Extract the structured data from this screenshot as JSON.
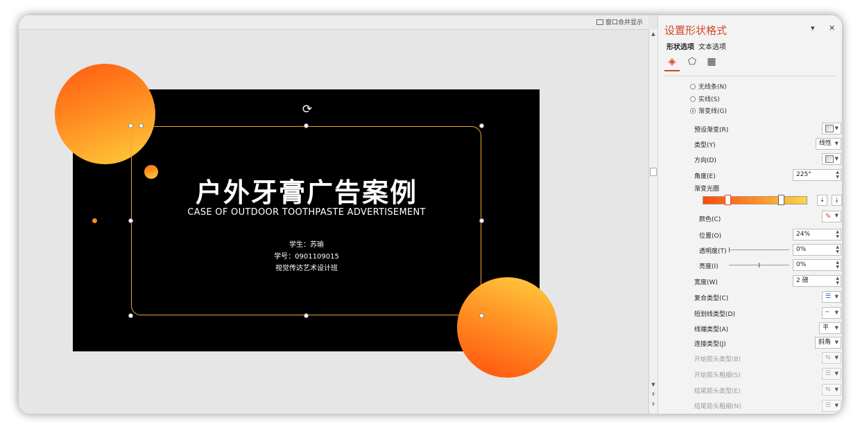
{
  "toolbar": {
    "merge_label": "窗口合并显示"
  },
  "slide": {
    "title": "户外牙膏广告案例",
    "subtitle": "CASE OF OUTDOOR TOOTHPASTE ADVERTISEMENT",
    "student": "学生：苏瑜",
    "student_id": "学号：0901109015",
    "class": "视觉传达艺术设计班"
  },
  "panel": {
    "title": "设置形状格式",
    "tabs": [
      "形状选项",
      "文本选项"
    ],
    "icons": [
      "fill-line-icon",
      "effects-icon",
      "size-properties-icon"
    ],
    "line_options": [
      {
        "label": "无线条(N)",
        "selected": false
      },
      {
        "label": "实线(S)",
        "selected": false
      },
      {
        "label": "渐变线(G)",
        "selected": true
      }
    ],
    "preset_gradient_label": "预设渐变(R)",
    "type_label": "类型(Y)",
    "type_value": "线性",
    "direction_label": "方向(D)",
    "angle_label": "角度(E)",
    "angle_value": "225°",
    "gradient_stops_label": "渐变光圈",
    "gradient_stop_positions": [
      0.24,
      0.75
    ],
    "color_label": "颜色(C)",
    "position_label": "位置(O)",
    "position_value": "24%",
    "transparency_label": "透明度(T)",
    "transparency_value": "0%",
    "brightness_label": "亮度(I)",
    "brightness_value": "0%",
    "width_label": "宽度(W)",
    "width_value": "2 磅",
    "compound_label": "复合类型(C)",
    "dash_label": "短划线类型(D)",
    "cap_label": "线端类型(A)",
    "cap_value": "平",
    "join_label": "连接类型(J)",
    "join_value": "斜角",
    "begin_arrow_type_label": "开始箭头类型(B)",
    "begin_arrow_size_label": "开始箭头粗细(S)",
    "end_arrow_type_label": "结尾箭头类型(E)",
    "end_arrow_size_label": "结尾箭头粗细(N)"
  },
  "colors": {
    "accent": "#d24726",
    "orange": "#ff5a10",
    "yellow": "#ffcf3c",
    "frame": "#f5a42b"
  }
}
